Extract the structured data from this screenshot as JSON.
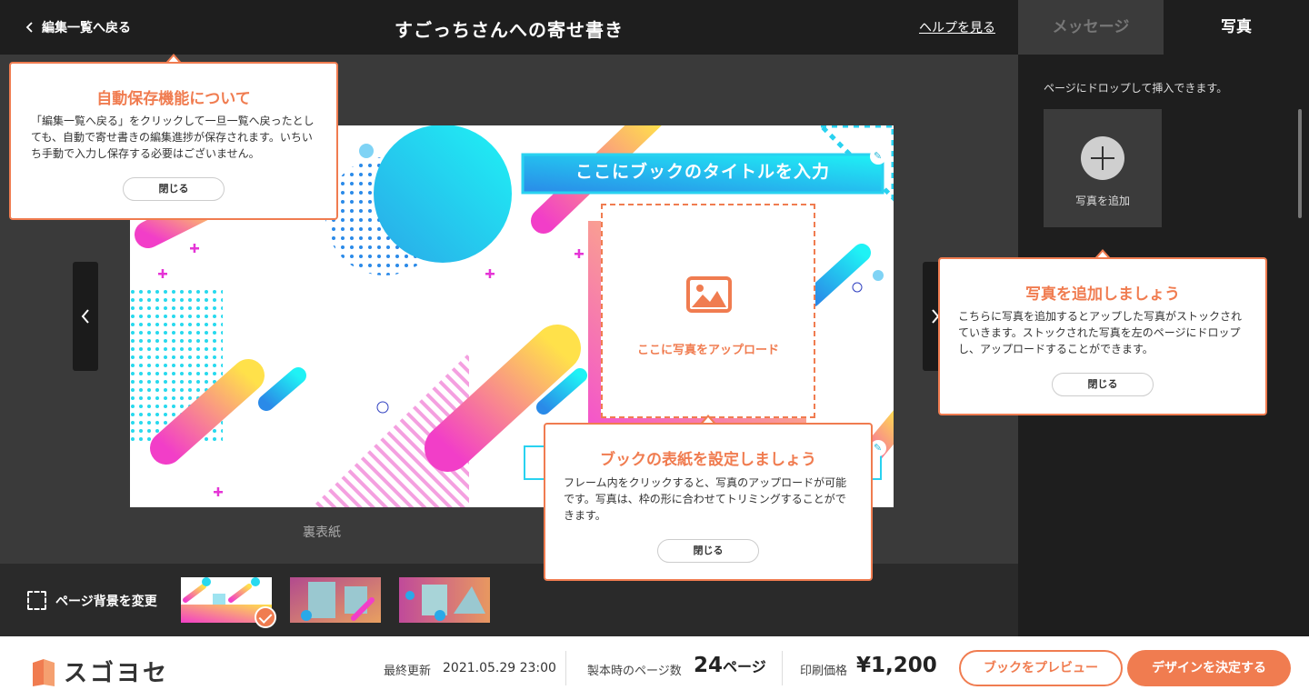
{
  "header": {
    "back_label": "編集一覧へ戻る",
    "title": "すごっちさんへの寄せ書き",
    "help_label": "ヘルプを見る"
  },
  "panel": {
    "tabs": [
      "メッセージ",
      "写真"
    ],
    "active_tab": "写真",
    "note": "ページにドロップして挿入できます。",
    "add_photo_label": "写真を追加"
  },
  "cover": {
    "title_placeholder": "ここにブックのタイトルを入力",
    "upload_label": "ここに写真をアップロード",
    "page_label": "裏表紙"
  },
  "tooltips": {
    "autosave": {
      "title": "自動保存機能について",
      "body": "「編集一覧へ戻る」をクリックして一旦一覧へ戻ったとしても、自動で寄せ書きの編集進捗が保存されます。いちいち手動で入力し保存する必要はございません。",
      "close": "閉じる"
    },
    "addphoto": {
      "title": "写真を追加しましょう",
      "body": "こちらに写真を追加するとアップした写真がストックされていきます。ストックされた写真を左のページにドロップし、アップロードすることができます。",
      "close": "閉じる"
    },
    "cover": {
      "title": "ブックの表紙を設定しましょう",
      "body": "フレーム内をクリックすると、写真のアップロードが可能です。写真は、枠の形に合わせてトリミングすることができます。",
      "close": "閉じる"
    }
  },
  "background_bar": {
    "label": "ページ背景を変更",
    "selected_index": 0
  },
  "footer": {
    "logo": "スゴヨセ",
    "last_updated_label": "最終更新",
    "last_updated": "2021.05.29 23:00",
    "pages_label": "製本時のページ数",
    "pages_value": "24",
    "pages_unit": "ページ",
    "price_label": "印刷価格",
    "price": "¥1,200",
    "preview_button": "ブックをプレビュー",
    "decide_button": "デザインを決定する"
  },
  "colors": {
    "accent": "#f07c50",
    "dark": "#1e1e1e",
    "editor_bg": "#3a3a3a",
    "cyan": "#1fe0f0",
    "pink": "#f24fc9",
    "yellow": "#ffe14a"
  }
}
